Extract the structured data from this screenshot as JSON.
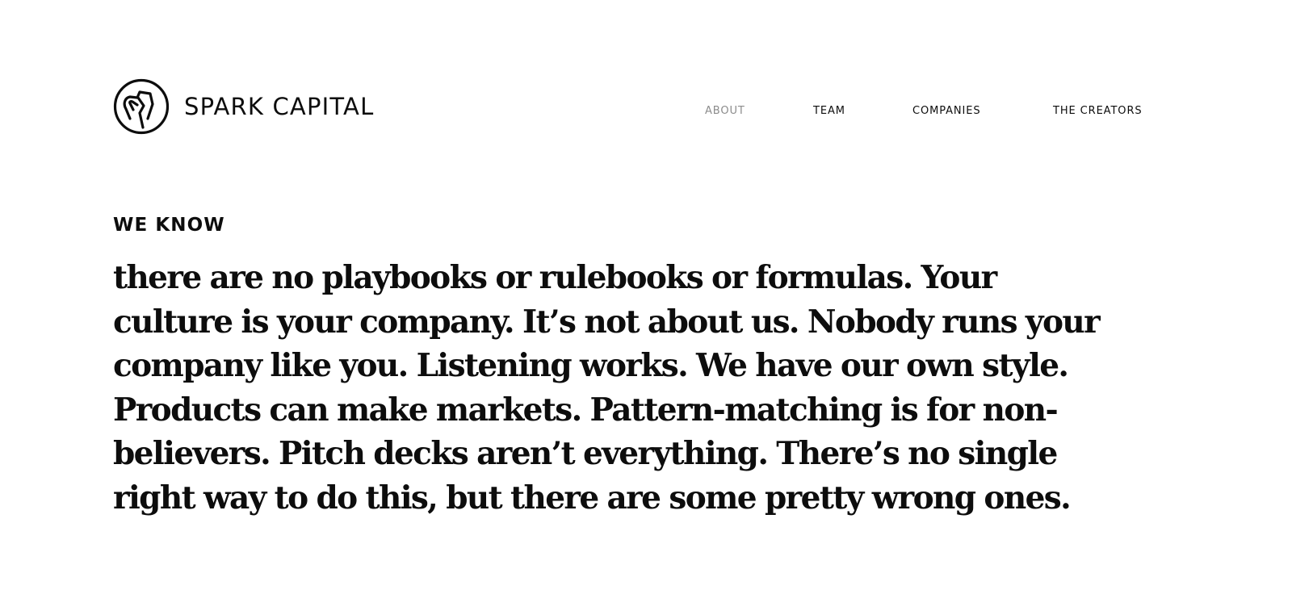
{
  "brand": {
    "name": "SPARK CAPITAL",
    "logo_icon": "spark-capital-logo-mark"
  },
  "nav": {
    "items": [
      {
        "label": "ABOUT",
        "active": true
      },
      {
        "label": "TEAM",
        "active": false
      },
      {
        "label": "COMPANIES",
        "active": false
      },
      {
        "label": "THE CREATORS",
        "active": false
      }
    ]
  },
  "colors": {
    "text": "#0d0d0d",
    "nav_active": "#8c8c8c",
    "background": "#ffffff"
  },
  "hero": {
    "eyebrow": "WE KNOW",
    "lines": [
      "there are no playbooks or rulebooks or formulas. Your",
      "culture is your company. It’s not about us. Nobody runs your",
      "company like you. Listening works. We have our own style.",
      "Products can make markets. Pattern-matching is for non-",
      "believers. Pitch decks aren’t everything. There’s no single",
      "right way to do this, but there are some pretty wrong ones."
    ]
  }
}
